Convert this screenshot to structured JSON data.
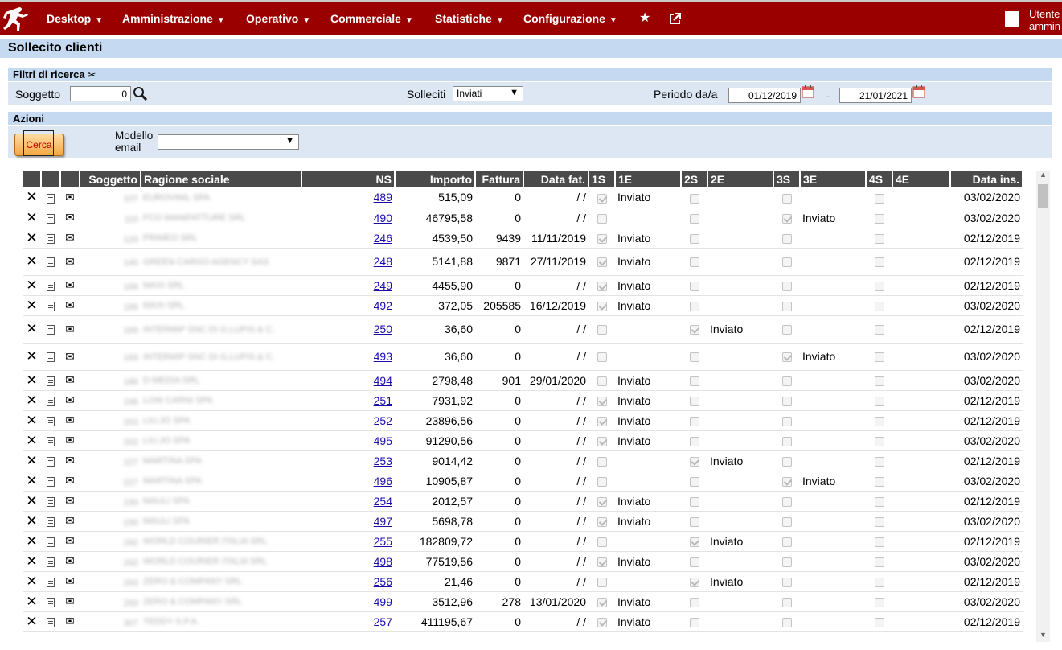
{
  "nav": {
    "items": [
      "Desktop",
      "Amministrazione",
      "Operativo",
      "Commerciale",
      "Statistiche",
      "Configurazione"
    ],
    "user_line1": "Utente",
    "user_line2": "ammin"
  },
  "page_title": "Sollecito clienti",
  "filters": {
    "title": "Filtri di ricerca",
    "soggetto_label": "Soggetto",
    "soggetto_value": "0",
    "solleciti_label": "Solleciti",
    "solleciti_value": "Inviati",
    "periodo_label": "Periodo da/a",
    "date_from": "01/12/2019",
    "date_sep": "-",
    "date_to": "21/01/2021"
  },
  "actions": {
    "title": "Azioni",
    "cerca_label": "Cerca",
    "modello_label_1": "Modello",
    "modello_label_2": "email",
    "modello_value": ""
  },
  "table": {
    "headers": [
      "",
      "",
      "",
      "Soggetto",
      "Ragione sociale",
      "NS",
      "Importo",
      "Fattura",
      "Data fat.",
      "1S",
      "1E",
      "2S",
      "2E",
      "3S",
      "3E",
      "4S",
      "4E",
      "Data ins."
    ],
    "rows": [
      {
        "sog": "107",
        "rag": "EUROVINIL SPA",
        "ns": "489",
        "imp": "515,09",
        "fat": "0",
        "dfat": "/ /",
        "s1": true,
        "e1": "Inviato",
        "s2": false,
        "e2": "",
        "s3": false,
        "e3": "",
        "s4": false,
        "e4": "",
        "dins": "03/02/2020",
        "tall": false
      },
      {
        "sog": "110",
        "rag": "FCO MANIFATTURE SRL",
        "ns": "490",
        "imp": "46795,58",
        "fat": "0",
        "dfat": "/ /",
        "s1": false,
        "e1": "",
        "s2": false,
        "e2": "",
        "s3": true,
        "e3": "Inviato",
        "s4": false,
        "e4": "",
        "dins": "03/02/2020",
        "tall": false
      },
      {
        "sog": "120",
        "rag": "PRIMEO SRL",
        "ns": "246",
        "imp": "4539,50",
        "fat": "9439",
        "dfat": "11/11/2019",
        "s1": true,
        "e1": "Inviato",
        "s2": false,
        "e2": "",
        "s3": false,
        "e3": "",
        "s4": false,
        "e4": "",
        "dins": "02/12/2019",
        "tall": false
      },
      {
        "sog": "140",
        "rag": "GREEN CARGO AGENCY SAS",
        "ns": "248",
        "imp": "5141,88",
        "fat": "9871",
        "dfat": "27/11/2019",
        "s1": true,
        "e1": "Inviato",
        "s2": false,
        "e2": "",
        "s3": false,
        "e3": "",
        "s4": false,
        "e4": "",
        "dins": "02/12/2019",
        "tall": true
      },
      {
        "sog": "166",
        "rag": "MAXI SRL",
        "ns": "249",
        "imp": "4455,90",
        "fat": "0",
        "dfat": "/ /",
        "s1": true,
        "e1": "Inviato",
        "s2": false,
        "e2": "",
        "s3": false,
        "e3": "",
        "s4": false,
        "e4": "",
        "dins": "02/12/2019",
        "tall": false
      },
      {
        "sog": "166",
        "rag": "MAXI SRL",
        "ns": "492",
        "imp": "372,05",
        "fat": "205585",
        "dfat": "16/12/2019",
        "s1": true,
        "e1": "Inviato",
        "s2": false,
        "e2": "",
        "s3": false,
        "e3": "",
        "s4": false,
        "e4": "",
        "dins": "03/02/2020",
        "tall": false
      },
      {
        "sog": "169",
        "rag": "INTERMIP SNC DI G.LUPIS & C.",
        "ns": "250",
        "imp": "36,60",
        "fat": "0",
        "dfat": "/ /",
        "s1": false,
        "e1": "",
        "s2": true,
        "e2": "Inviato",
        "s3": false,
        "e3": "",
        "s4": false,
        "e4": "",
        "dins": "02/12/2019",
        "tall": true
      },
      {
        "sog": "169",
        "rag": "INTERMIP SNC DI G.LUPIS & C.",
        "ns": "493",
        "imp": "36,60",
        "fat": "0",
        "dfat": "/ /",
        "s1": false,
        "e1": "",
        "s2": false,
        "e2": "",
        "s3": true,
        "e3": "Inviato",
        "s4": false,
        "e4": "",
        "dins": "03/02/2020",
        "tall": true
      },
      {
        "sog": "186",
        "rag": "D-MEDIA SRL",
        "ns": "494",
        "imp": "2798,48",
        "fat": "901",
        "dfat": "29/01/2020",
        "s1": false,
        "e1": "Inviato",
        "s2": false,
        "e2": "",
        "s3": false,
        "e3": "",
        "s4": false,
        "e4": "",
        "dins": "03/02/2020",
        "tall": false
      },
      {
        "sog": "196",
        "rag": "LOW CARNI SPA",
        "ns": "251",
        "imp": "7931,92",
        "fat": "0",
        "dfat": "/ /",
        "s1": true,
        "e1": "Inviato",
        "s2": false,
        "e2": "",
        "s3": false,
        "e3": "",
        "s4": false,
        "e4": "",
        "dins": "02/12/2019",
        "tall": false
      },
      {
        "sog": "202",
        "rag": "LIU.JO SPA",
        "ns": "252",
        "imp": "23896,56",
        "fat": "0",
        "dfat": "/ /",
        "s1": true,
        "e1": "Inviato",
        "s2": false,
        "e2": "",
        "s3": false,
        "e3": "",
        "s4": false,
        "e4": "",
        "dins": "02/12/2019",
        "tall": false
      },
      {
        "sog": "202",
        "rag": "LIU.JO SPA",
        "ns": "495",
        "imp": "91290,56",
        "fat": "0",
        "dfat": "/ /",
        "s1": true,
        "e1": "Inviato",
        "s2": false,
        "e2": "",
        "s3": false,
        "e3": "",
        "s4": false,
        "e4": "",
        "dins": "03/02/2020",
        "tall": false
      },
      {
        "sog": "227",
        "rag": "MARTINA SPA",
        "ns": "253",
        "imp": "9014,42",
        "fat": "0",
        "dfat": "/ /",
        "s1": false,
        "e1": "",
        "s2": true,
        "e2": "Inviato",
        "s3": false,
        "e3": "",
        "s4": false,
        "e4": "",
        "dins": "02/12/2019",
        "tall": false
      },
      {
        "sog": "227",
        "rag": "MARTINA SPA",
        "ns": "496",
        "imp": "10905,87",
        "fat": "0",
        "dfat": "/ /",
        "s1": false,
        "e1": "",
        "s2": false,
        "e2": "",
        "s3": true,
        "e3": "Inviato",
        "s4": false,
        "e4": "",
        "dins": "03/02/2020",
        "tall": false
      },
      {
        "sog": "230",
        "rag": "MAULI SPA",
        "ns": "254",
        "imp": "2012,57",
        "fat": "0",
        "dfat": "/ /",
        "s1": true,
        "e1": "Inviato",
        "s2": false,
        "e2": "",
        "s3": false,
        "e3": "",
        "s4": false,
        "e4": "",
        "dins": "02/12/2019",
        "tall": false
      },
      {
        "sog": "230",
        "rag": "MAULI SPA",
        "ns": "497",
        "imp": "5698,78",
        "fat": "0",
        "dfat": "/ /",
        "s1": true,
        "e1": "Inviato",
        "s2": false,
        "e2": "",
        "s3": false,
        "e3": "",
        "s4": false,
        "e4": "",
        "dins": "03/02/2020",
        "tall": false
      },
      {
        "sog": "292",
        "rag": "WORLD COURIER ITALIA SRL",
        "ns": "255",
        "imp": "182809,72",
        "fat": "0",
        "dfat": "/ /",
        "s1": false,
        "e1": "",
        "s2": true,
        "e2": "Inviato",
        "s3": false,
        "e3": "",
        "s4": false,
        "e4": "",
        "dins": "02/12/2019",
        "tall": false
      },
      {
        "sog": "292",
        "rag": "WORLD COURIER ITALIA SRL",
        "ns": "498",
        "imp": "77519,56",
        "fat": "0",
        "dfat": "/ /",
        "s1": true,
        "e1": "Inviato",
        "s2": false,
        "e2": "",
        "s3": false,
        "e3": "",
        "s4": false,
        "e4": "",
        "dins": "03/02/2020",
        "tall": false
      },
      {
        "sog": "293",
        "rag": "ZERO & COMPANY SRL",
        "ns": "256",
        "imp": "21,46",
        "fat": "0",
        "dfat": "/ /",
        "s1": false,
        "e1": "",
        "s2": true,
        "e2": "Inviato",
        "s3": false,
        "e3": "",
        "s4": false,
        "e4": "",
        "dins": "02/12/2019",
        "tall": false
      },
      {
        "sog": "293",
        "rag": "ZERO & COMPANY SRL",
        "ns": "499",
        "imp": "3512,96",
        "fat": "278",
        "dfat": "13/01/2020",
        "s1": true,
        "e1": "Inviato",
        "s2": false,
        "e2": "",
        "s3": false,
        "e3": "",
        "s4": false,
        "e4": "",
        "dins": "03/02/2020",
        "tall": false
      },
      {
        "sog": "307",
        "rag": "TEDDY S.P.A.",
        "ns": "257",
        "imp": "411195,67",
        "fat": "0",
        "dfat": "/ /",
        "s1": true,
        "e1": "Inviato",
        "s2": false,
        "e2": "",
        "s3": false,
        "e3": "",
        "s4": false,
        "e4": "",
        "dins": "02/12/2019",
        "tall": false
      }
    ]
  },
  "colors": {
    "nav_bg": "#9b0000",
    "section_bg": "#c5d9f1",
    "header_bg": "#4a4a4a"
  }
}
